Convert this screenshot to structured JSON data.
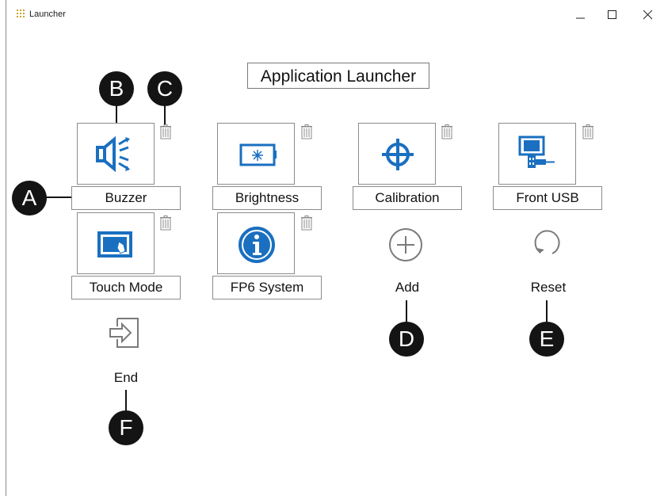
{
  "window": {
    "title": "Launcher",
    "controls": {
      "minimize": "–",
      "maximize": "□",
      "close": "×"
    }
  },
  "header": {
    "title": "Application Launcher"
  },
  "tiles": [
    {
      "label": "Buzzer",
      "icon": "speaker-icon"
    },
    {
      "label": "Brightness",
      "icon": "brightness-icon"
    },
    {
      "label": "Calibration",
      "icon": "crosshair-icon"
    },
    {
      "label": "Front USB",
      "icon": "usb-icon"
    },
    {
      "label": "Touch Mode",
      "icon": "touch-icon"
    },
    {
      "label": "FP6 System",
      "icon": "info-icon"
    }
  ],
  "actions": {
    "add": "Add",
    "reset": "Reset",
    "end": "End"
  },
  "callouts": [
    "A",
    "B",
    "C",
    "D",
    "E",
    "F"
  ],
  "colors": {
    "accent": "#1a6fc0",
    "callout": "#141414"
  }
}
